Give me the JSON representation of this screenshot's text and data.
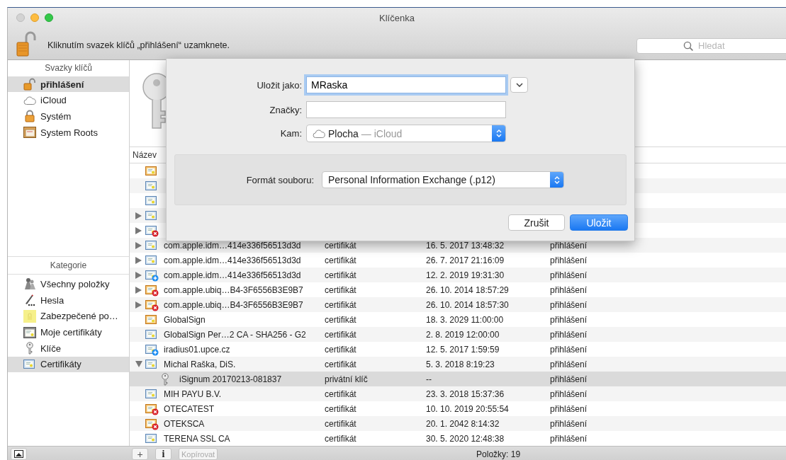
{
  "window": {
    "title": "Klíčenka",
    "traffic_lights": [
      {
        "kind": "close",
        "disabled": true
      },
      {
        "kind": "minimize",
        "disabled": false
      },
      {
        "kind": "zoom",
        "disabled": false
      }
    ]
  },
  "toolbar": {
    "lock_message": "Kliknutím svazek klíčů „přihlášení“ uzamknete.",
    "search": {
      "placeholder": "Hledat"
    }
  },
  "sidebar": {
    "keychains_header": "Svazky klíčů",
    "keychains": [
      {
        "label": "přihlášení",
        "kind": "lock-open",
        "selected": true
      },
      {
        "label": "iCloud",
        "kind": "cloud",
        "selected": false
      },
      {
        "label": "Systém",
        "kind": "lock",
        "selected": false
      },
      {
        "label": "System Roots",
        "kind": "cabinet",
        "selected": false
      }
    ],
    "categories_header": "Kategorie",
    "categories": [
      {
        "label": "Všechny položky",
        "kind": "people",
        "selected": false
      },
      {
        "label": "Hesla",
        "kind": "pen",
        "selected": false
      },
      {
        "label": "Zabezpečené po…",
        "kind": "note",
        "selected": false
      },
      {
        "label": "Moje certifikáty",
        "kind": "mycert",
        "selected": false
      },
      {
        "label": "Klíče",
        "kind": "key",
        "selected": false
      },
      {
        "label": "Certifikáty",
        "kind": "cert",
        "selected": true
      }
    ]
  },
  "table": {
    "columns": [
      "Název"
    ],
    "rows": [
      {
        "kind": "cert-orange",
        "expandable": false,
        "selected": false
      },
      {
        "kind": "cert",
        "expandable": false,
        "selected": false
      },
      {
        "kind": "cert",
        "expandable": false,
        "selected": false
      },
      {
        "kind": "cert",
        "expandable": true,
        "expanded": false,
        "selected": false
      },
      {
        "kind": "cert-error",
        "expandable": true,
        "expanded": false,
        "selected": false
      },
      {
        "name": "com.apple.idm…414e336f56513d3d",
        "type": "certifikát",
        "date": "16. 5. 2017 13:48:32",
        "keychain": "přihlášení",
        "kind": "cert",
        "expandable": true,
        "expanded": false,
        "selected": false
      },
      {
        "name": "com.apple.idm…414e336f56513d3d",
        "type": "certifikát",
        "date": "26. 7. 2017 21:16:09",
        "keychain": "přihlášení",
        "kind": "cert",
        "expandable": true,
        "expanded": false,
        "selected": false
      },
      {
        "name": "com.apple.idm…414e336f56513d3d",
        "type": "certifikát",
        "date": "12. 2. 2019 19:31:30",
        "keychain": "přihlášení",
        "kind": "cert-plus",
        "expandable": true,
        "expanded": false,
        "selected": false
      },
      {
        "name": "com.apple.ubiq…B4-3F6556B3E9B7",
        "type": "certifikát",
        "date": "26. 10. 2014 18:57:29",
        "keychain": "přihlášení",
        "kind": "cert-orange-error",
        "expandable": true,
        "expanded": false,
        "selected": false
      },
      {
        "name": "com.apple.ubiq…B4-3F6556B3E9B7",
        "type": "certifikát",
        "date": "26. 10. 2014 18:57:30",
        "keychain": "přihlášení",
        "kind": "cert-orange-error",
        "expandable": true,
        "expanded": false,
        "selected": false
      },
      {
        "name": "GlobalSign",
        "type": "certifikát",
        "date": "18. 3. 2029 11:00:00",
        "keychain": "přihlášení",
        "kind": "cert-orange",
        "expandable": false,
        "selected": false
      },
      {
        "name": "GlobalSign Per…2 CA - SHA256 - G2",
        "type": "certifikát",
        "date": "2. 8. 2019 12:00:00",
        "keychain": "přihlášení",
        "kind": "cert",
        "expandable": false,
        "selected": false
      },
      {
        "name": "iradius01.upce.cz",
        "type": "certifikát",
        "date": "12. 5. 2017 1:59:59",
        "keychain": "přihlášení",
        "kind": "cert-plus",
        "expandable": false,
        "selected": false
      },
      {
        "name": "Michal Raška, DiS.",
        "type": "certifikát",
        "date": "5. 3. 2018 8:19:23",
        "keychain": "přihlášení",
        "kind": "cert",
        "expandable": true,
        "expanded": true,
        "selected": false,
        "children": [
          {
            "name": "iSignum 20170213-081837",
            "type": "privátní klíč",
            "date": "--",
            "keychain": "přihlášení",
            "kind": "key",
            "expandable": false,
            "selected": true
          }
        ]
      },
      {
        "name": "MIH PAYU B.V.",
        "type": "certifikát",
        "date": "23. 3. 2018 15:37:36",
        "keychain": "přihlášení",
        "kind": "cert",
        "expandable": false,
        "selected": false
      },
      {
        "name": "OTECATEST",
        "type": "certifikát",
        "date": "10. 10. 2019 20:55:54",
        "keychain": "přihlášení",
        "kind": "cert-orange-error",
        "expandable": false,
        "selected": false
      },
      {
        "name": "OTEKSCA",
        "type": "certifikát",
        "date": "20. 1. 2042 8:14:32",
        "keychain": "přihlášení",
        "kind": "cert-orange-error",
        "expandable": false,
        "selected": false
      },
      {
        "name": "TERENA SSL CA",
        "type": "certifikát",
        "date": "30. 5. 2020 12:48:38",
        "keychain": "přihlášení",
        "kind": "cert",
        "expandable": false,
        "selected": false
      }
    ]
  },
  "bottom_bar": {
    "add_button": "+",
    "info_button": "i",
    "copy_button": {
      "label": "Kopírovat",
      "disabled": true
    },
    "status": "Položky: 19"
  },
  "save_sheet": {
    "save_as": {
      "label": "Uložit jako:",
      "value": "MRaska",
      "focused": true
    },
    "tags": {
      "label": "Značky:"
    },
    "where": {
      "label": "Kam:",
      "value": "Plocha",
      "detail": "— iCloud"
    },
    "format": {
      "label": "Formát souboru:",
      "value": "Personal Information Exchange (.p12)"
    },
    "buttons": [
      {
        "label": "Zrušit",
        "default": false
      },
      {
        "label": "Uložit",
        "default": true
      }
    ]
  }
}
